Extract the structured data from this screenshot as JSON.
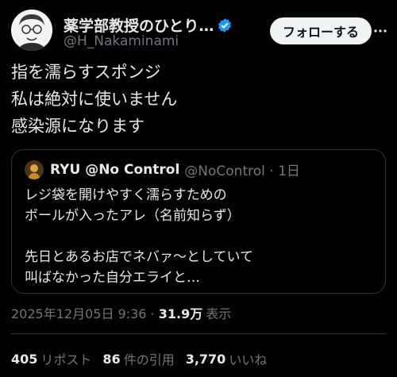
{
  "author": {
    "display_name": "薬学部教授のひとり…",
    "handle": "@H_Nakaminami",
    "verified": true,
    "verified_color": "#1d9bf0"
  },
  "follow_button": {
    "label": "フォローする"
  },
  "tweet": {
    "lines": [
      "指を濡らすスポンジ",
      "私は絶対に使いません",
      "感染源になります"
    ]
  },
  "quote": {
    "name": "RYU @No Control",
    "handle": "@NoControl · 1日",
    "lines": [
      "レジ袋を開けやすく濡らすための",
      "ボールが入ったアレ（名前知らず）",
      "",
      "先日とあるお店でネバァ〜としていて",
      "叫ばなかった自分エライと…"
    ]
  },
  "meta": {
    "timestamp": "2025年12月05日 9:36 · ",
    "views_count": "31.9万",
    "views_label": "表示"
  },
  "stats": {
    "reposts_count": "405",
    "reposts_label": "リポスト",
    "quotes_count": "86",
    "quotes_label": "件の引用",
    "likes_count": "3,770",
    "likes_label": "いいね"
  }
}
